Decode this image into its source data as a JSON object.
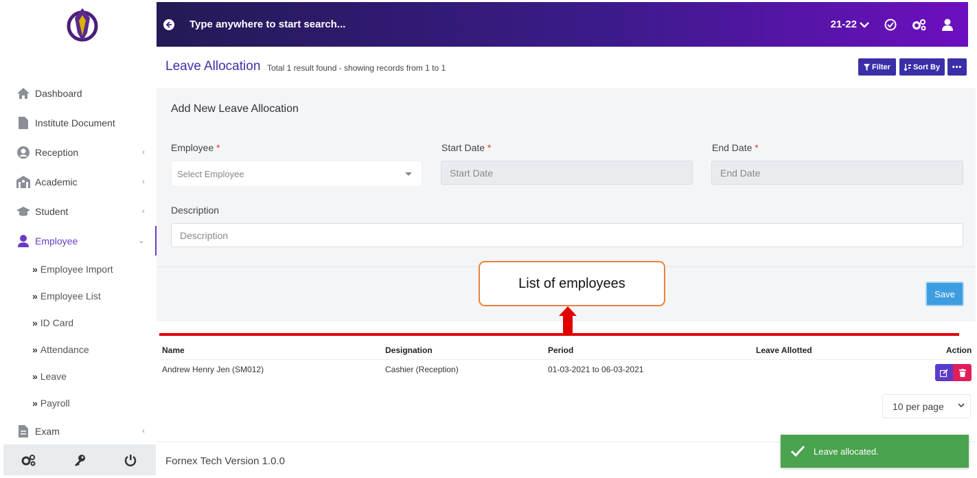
{
  "topbar": {
    "search_placeholder": "Type anywhere to start search...",
    "session": "21-22"
  },
  "sidebar": {
    "items": [
      {
        "label": "Dashboard"
      },
      {
        "label": "Institute Document"
      },
      {
        "label": "Reception"
      },
      {
        "label": "Academic"
      },
      {
        "label": "Student"
      },
      {
        "label": "Employee"
      },
      {
        "label": "Exam"
      }
    ],
    "employee_submenu": [
      {
        "label": "Employee Import"
      },
      {
        "label": "Employee List"
      },
      {
        "label": "ID Card"
      },
      {
        "label": "Attendance"
      },
      {
        "label": "Leave"
      },
      {
        "label": "Payroll"
      }
    ]
  },
  "header": {
    "title": "Leave Allocation",
    "result_text": "Total 1 result found - showing records from 1 to 1",
    "filter_label": "Filter",
    "sort_label": "Sort By"
  },
  "form": {
    "title": "Add New Leave Allocation",
    "employee_label": "Employee",
    "employee_placeholder": "Select Employee",
    "start_label": "Start Date",
    "start_placeholder": "Start Date",
    "end_label": "End Date",
    "end_placeholder": "End Date",
    "description_label": "Description",
    "description_placeholder": "Description",
    "required_mark": "*",
    "save_label": "Save"
  },
  "callout": {
    "text": "List of employees",
    "accent": "#e00000",
    "border": "#e8823a"
  },
  "table": {
    "columns": [
      "Name",
      "Designation",
      "Period",
      "Leave Allotted",
      "Action"
    ],
    "rows": [
      {
        "name": "Andrew Henry Jen (SM012)",
        "designation": "Cashier (Reception)",
        "period": "01-03-2021 to 06-03-2021",
        "leave_allotted": ""
      }
    ]
  },
  "pagination": {
    "per_page": "10 per page"
  },
  "footer": {
    "version": "Fornex Tech Version 1.0.0"
  },
  "toast": {
    "message": "Leave allocated.",
    "color": "#4aa34e"
  },
  "colors": {
    "brand": "#3b2fa8",
    "accent": "#6a3bc9"
  }
}
